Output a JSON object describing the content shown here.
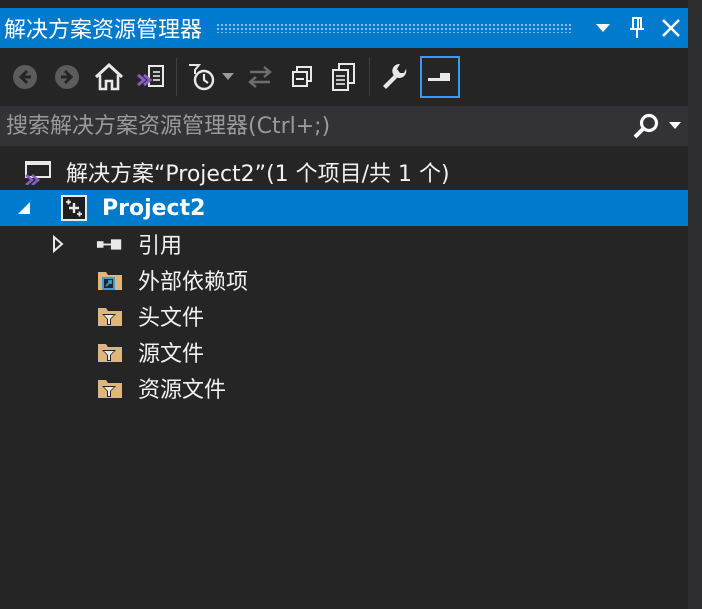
{
  "titlebar": {
    "title": "解决方案资源管理器",
    "dropdown_icon": "triangle-down-icon",
    "pin_icon": "pin-icon",
    "close_icon": "close-icon"
  },
  "toolbar": {
    "items": [
      "back-icon",
      "forward-icon",
      "home-icon",
      "vs-switch-view-icon",
      "pending-changes-filter-icon",
      "dropdown-arrow-icon",
      "sync-active-document-icon",
      "collapse-all-icon",
      "show-all-files-icon",
      "properties-wrench-icon",
      "preview-selected-items-icon"
    ]
  },
  "search": {
    "placeholder": "搜索解决方案资源管理器(Ctrl+;)",
    "search_icon": "search-icon",
    "options_icon": "triangle-down-icon"
  },
  "tree": {
    "solution": {
      "label": "解决方案“Project2”(1 个项目/共 1 个)"
    },
    "project": {
      "label": "Project2"
    },
    "items": [
      {
        "label": "引用"
      },
      {
        "label": "外部依赖项"
      },
      {
        "label": "头文件"
      },
      {
        "label": "源文件"
      },
      {
        "label": "资源文件"
      }
    ]
  },
  "colors": {
    "accent": "#007acc",
    "background": "#252526",
    "search_bg": "#333337",
    "folder": "#dcb67a",
    "vs_purple": "#865fc5"
  }
}
